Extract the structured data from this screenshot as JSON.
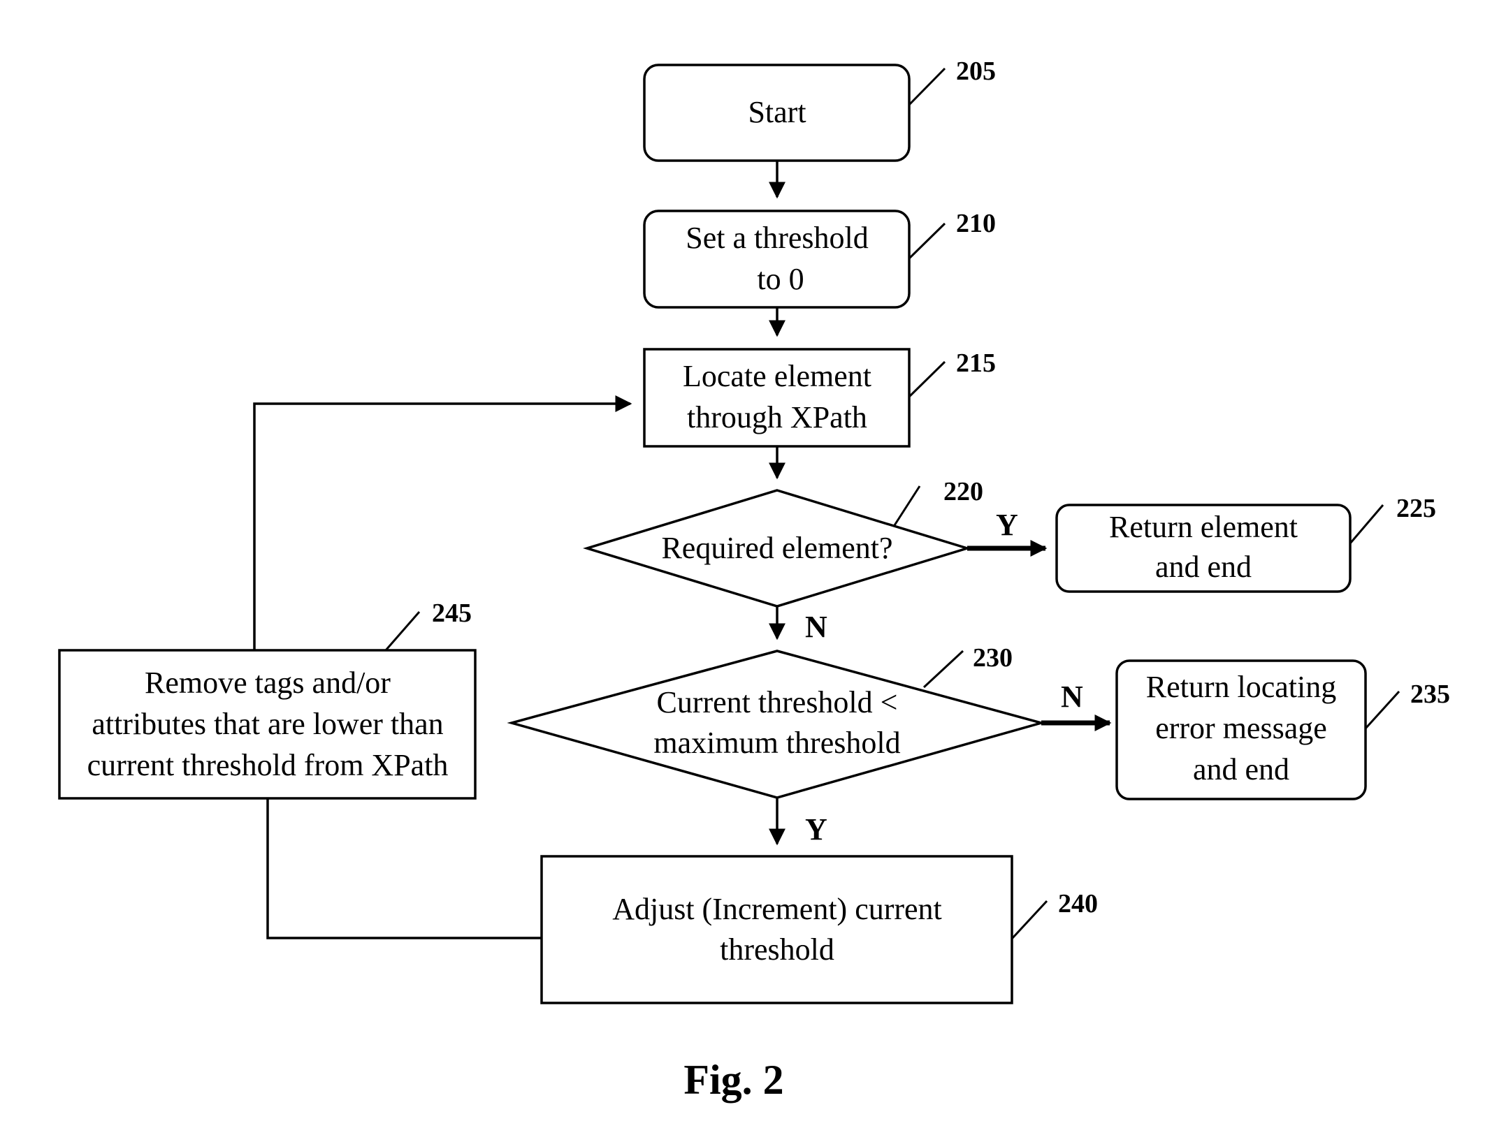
{
  "figure": {
    "caption": "Fig. 2",
    "colors": {
      "ink": "#000000",
      "background": "#ffffff"
    }
  },
  "nodes": {
    "start": {
      "ref": "205",
      "shape": "rounded-rect",
      "lines": [
        "Start"
      ]
    },
    "set_thresh": {
      "ref": "210",
      "shape": "rounded-rect",
      "lines": [
        "Set a threshold",
        "to 0"
      ]
    },
    "locate": {
      "ref": "215",
      "shape": "rect",
      "lines": [
        "Locate element",
        "through XPath"
      ]
    },
    "required": {
      "ref": "220",
      "shape": "diamond",
      "lines": [
        "Required element?"
      ]
    },
    "return_el": {
      "ref": "225",
      "shape": "rounded-rect",
      "lines": [
        "Return element",
        "and end"
      ]
    },
    "compare": {
      "ref": "230",
      "shape": "diamond",
      "lines": [
        "Current threshold <",
        "maximum threshold"
      ]
    },
    "return_err": {
      "ref": "235",
      "shape": "rounded-rect",
      "lines": [
        "Return locating",
        "error message",
        "and end"
      ]
    },
    "adjust": {
      "ref": "240",
      "shape": "rect",
      "lines": [
        "Adjust (Increment) current",
        "threshold"
      ]
    },
    "remove": {
      "ref": "245",
      "shape": "rect",
      "lines": [
        "Remove tags and/or",
        "attributes that are lower than",
        "current threshold from XPath"
      ]
    }
  },
  "edges": [
    {
      "from": "205",
      "to": "210",
      "label": ""
    },
    {
      "from": "210",
      "to": "215",
      "label": ""
    },
    {
      "from": "215",
      "to": "220",
      "label": ""
    },
    {
      "from": "220",
      "to": "225",
      "label": "Y"
    },
    {
      "from": "220",
      "to": "230",
      "label": "N"
    },
    {
      "from": "230",
      "to": "235",
      "label": "N"
    },
    {
      "from": "230",
      "to": "240",
      "label": "Y"
    },
    {
      "from": "240",
      "to": "245",
      "label": ""
    },
    {
      "from": "245",
      "to": "215",
      "label": ""
    }
  ],
  "edge_labels": {
    "req_yes": "Y",
    "req_no": "N",
    "cmp_no": "N",
    "cmp_yes": "Y"
  }
}
